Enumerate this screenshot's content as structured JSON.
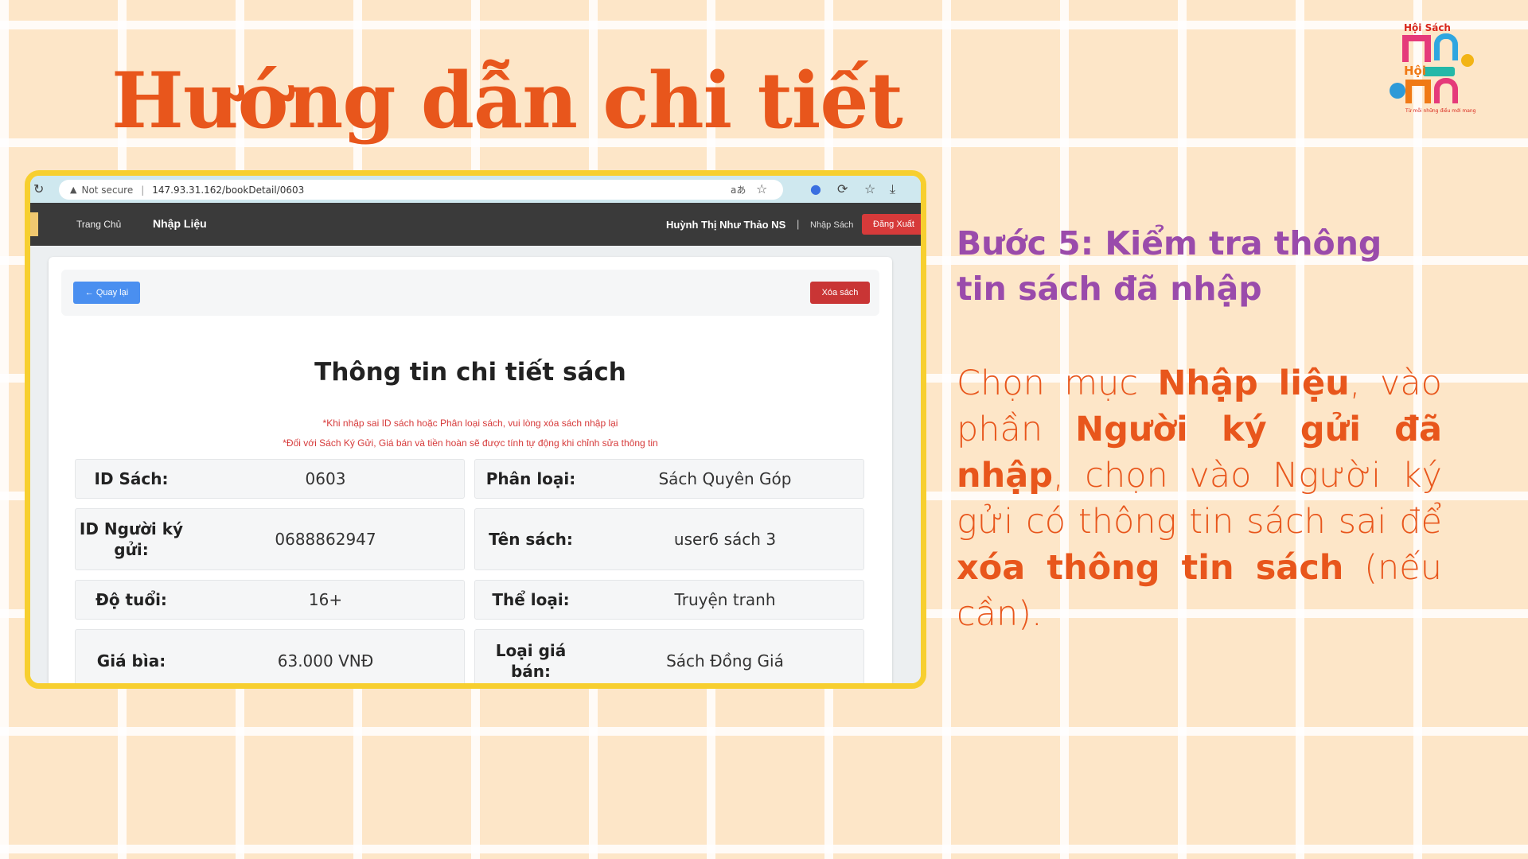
{
  "title": "Hướng dẫn chi tiết",
  "logo": {
    "top_text": "Hội Sách",
    "mid_text": "Hội",
    "tagline": "Từ mỗi những điều mới mang"
  },
  "browser": {
    "security_label": "Not secure",
    "url": "147.93.31.162/bookDetail/0603",
    "translate_icon": "aあ"
  },
  "navbar": {
    "home": "Trang Chủ",
    "data_entry": "Nhập Liệu",
    "user": "Huỳnh Thị Như Thảo NS",
    "separator": "|",
    "enter_books": "Nhập Sách",
    "logout": "Đăng Xuất"
  },
  "card": {
    "back_button": "← Quay lại",
    "delete_button": "Xóa sách",
    "title": "Thông tin chi tiết sách",
    "note1": "*Khi nhập sai ID sách hoặc Phân loại sách, vui lòng xóa sách nhập lại",
    "note2": "*Đối với Sách Ký Gửi, Giá bán và tiền hoàn sẽ được tính tự động khi chỉnh sửa thông tin",
    "fields": [
      {
        "label": "ID Sách:",
        "value": "0603"
      },
      {
        "label": "Phân loại:",
        "value": "Sách Quyên Góp"
      },
      {
        "label": "ID Người ký gửi:",
        "value": "0688862947"
      },
      {
        "label": "Tên sách:",
        "value": "user6 sách 3"
      },
      {
        "label": "Độ tuổi:",
        "value": "16+"
      },
      {
        "label": "Thể loại:",
        "value": "Truyện tranh"
      },
      {
        "label": "Giá bìa:",
        "value": "63.000 VNĐ"
      },
      {
        "label": "Loại giá bán:",
        "value": "Sách Đồng Giá"
      }
    ]
  },
  "step": {
    "title": "Bước 5: Kiểm tra thông tin sách đã nhập",
    "body_1": "Chọn mục ",
    "body_2": "Nhập liệu",
    "body_3": ", vào phần ",
    "body_4": "Người ký gửi đã nhập",
    "body_5": ", chọn vào Người ký gửi có thông tin sách sai để ",
    "body_6": "xóa thông tin sách",
    "body_7": " (nếu cần)."
  },
  "colors": {
    "background": "#fde6c8",
    "title": "#e8561c",
    "step_title": "#9a4bab",
    "frame_border": "#f7cf2f",
    "back_button": "#4a8ff0",
    "delete_button": "#c93535"
  }
}
